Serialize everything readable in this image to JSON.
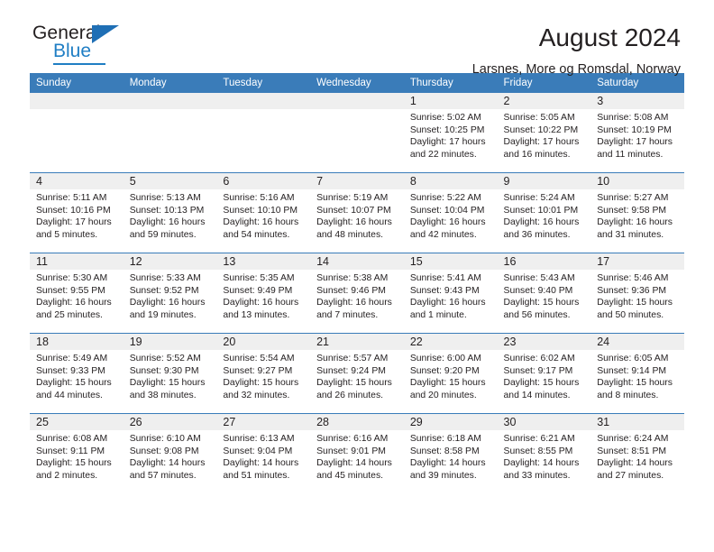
{
  "brand": {
    "name_top": "General",
    "name_bottom": "Blue",
    "triangle_color": "#1f6fb5",
    "blue_color": "#1f7ec4"
  },
  "header": {
    "title": "August 2024",
    "subtitle": "Larsnes, More og Romsdal, Norway",
    "header_bg": "#3a7cb9",
    "daynum_bg": "#efefef"
  },
  "weekdays": [
    "Sunday",
    "Monday",
    "Tuesday",
    "Wednesday",
    "Thursday",
    "Friday",
    "Saturday"
  ],
  "weeks": [
    [
      {
        "day": "",
        "empty": true
      },
      {
        "day": "",
        "empty": true
      },
      {
        "day": "",
        "empty": true
      },
      {
        "day": "",
        "empty": true
      },
      {
        "day": "1",
        "sunrise": "Sunrise: 5:02 AM",
        "sunset": "Sunset: 10:25 PM",
        "daylight1": "Daylight: 17 hours",
        "daylight2": "and 22 minutes."
      },
      {
        "day": "2",
        "sunrise": "Sunrise: 5:05 AM",
        "sunset": "Sunset: 10:22 PM",
        "daylight1": "Daylight: 17 hours",
        "daylight2": "and 16 minutes."
      },
      {
        "day": "3",
        "sunrise": "Sunrise: 5:08 AM",
        "sunset": "Sunset: 10:19 PM",
        "daylight1": "Daylight: 17 hours",
        "daylight2": "and 11 minutes."
      }
    ],
    [
      {
        "day": "4",
        "sunrise": "Sunrise: 5:11 AM",
        "sunset": "Sunset: 10:16 PM",
        "daylight1": "Daylight: 17 hours",
        "daylight2": "and 5 minutes."
      },
      {
        "day": "5",
        "sunrise": "Sunrise: 5:13 AM",
        "sunset": "Sunset: 10:13 PM",
        "daylight1": "Daylight: 16 hours",
        "daylight2": "and 59 minutes."
      },
      {
        "day": "6",
        "sunrise": "Sunrise: 5:16 AM",
        "sunset": "Sunset: 10:10 PM",
        "daylight1": "Daylight: 16 hours",
        "daylight2": "and 54 minutes."
      },
      {
        "day": "7",
        "sunrise": "Sunrise: 5:19 AM",
        "sunset": "Sunset: 10:07 PM",
        "daylight1": "Daylight: 16 hours",
        "daylight2": "and 48 minutes."
      },
      {
        "day": "8",
        "sunrise": "Sunrise: 5:22 AM",
        "sunset": "Sunset: 10:04 PM",
        "daylight1": "Daylight: 16 hours",
        "daylight2": "and 42 minutes."
      },
      {
        "day": "9",
        "sunrise": "Sunrise: 5:24 AM",
        "sunset": "Sunset: 10:01 PM",
        "daylight1": "Daylight: 16 hours",
        "daylight2": "and 36 minutes."
      },
      {
        "day": "10",
        "sunrise": "Sunrise: 5:27 AM",
        "sunset": "Sunset: 9:58 PM",
        "daylight1": "Daylight: 16 hours",
        "daylight2": "and 31 minutes."
      }
    ],
    [
      {
        "day": "11",
        "sunrise": "Sunrise: 5:30 AM",
        "sunset": "Sunset: 9:55 PM",
        "daylight1": "Daylight: 16 hours",
        "daylight2": "and 25 minutes."
      },
      {
        "day": "12",
        "sunrise": "Sunrise: 5:33 AM",
        "sunset": "Sunset: 9:52 PM",
        "daylight1": "Daylight: 16 hours",
        "daylight2": "and 19 minutes."
      },
      {
        "day": "13",
        "sunrise": "Sunrise: 5:35 AM",
        "sunset": "Sunset: 9:49 PM",
        "daylight1": "Daylight: 16 hours",
        "daylight2": "and 13 minutes."
      },
      {
        "day": "14",
        "sunrise": "Sunrise: 5:38 AM",
        "sunset": "Sunset: 9:46 PM",
        "daylight1": "Daylight: 16 hours",
        "daylight2": "and 7 minutes."
      },
      {
        "day": "15",
        "sunrise": "Sunrise: 5:41 AM",
        "sunset": "Sunset: 9:43 PM",
        "daylight1": "Daylight: 16 hours",
        "daylight2": "and 1 minute."
      },
      {
        "day": "16",
        "sunrise": "Sunrise: 5:43 AM",
        "sunset": "Sunset: 9:40 PM",
        "daylight1": "Daylight: 15 hours",
        "daylight2": "and 56 minutes."
      },
      {
        "day": "17",
        "sunrise": "Sunrise: 5:46 AM",
        "sunset": "Sunset: 9:36 PM",
        "daylight1": "Daylight: 15 hours",
        "daylight2": "and 50 minutes."
      }
    ],
    [
      {
        "day": "18",
        "sunrise": "Sunrise: 5:49 AM",
        "sunset": "Sunset: 9:33 PM",
        "daylight1": "Daylight: 15 hours",
        "daylight2": "and 44 minutes."
      },
      {
        "day": "19",
        "sunrise": "Sunrise: 5:52 AM",
        "sunset": "Sunset: 9:30 PM",
        "daylight1": "Daylight: 15 hours",
        "daylight2": "and 38 minutes."
      },
      {
        "day": "20",
        "sunrise": "Sunrise: 5:54 AM",
        "sunset": "Sunset: 9:27 PM",
        "daylight1": "Daylight: 15 hours",
        "daylight2": "and 32 minutes."
      },
      {
        "day": "21",
        "sunrise": "Sunrise: 5:57 AM",
        "sunset": "Sunset: 9:24 PM",
        "daylight1": "Daylight: 15 hours",
        "daylight2": "and 26 minutes."
      },
      {
        "day": "22",
        "sunrise": "Sunrise: 6:00 AM",
        "sunset": "Sunset: 9:20 PM",
        "daylight1": "Daylight: 15 hours",
        "daylight2": "and 20 minutes."
      },
      {
        "day": "23",
        "sunrise": "Sunrise: 6:02 AM",
        "sunset": "Sunset: 9:17 PM",
        "daylight1": "Daylight: 15 hours",
        "daylight2": "and 14 minutes."
      },
      {
        "day": "24",
        "sunrise": "Sunrise: 6:05 AM",
        "sunset": "Sunset: 9:14 PM",
        "daylight1": "Daylight: 15 hours",
        "daylight2": "and 8 minutes."
      }
    ],
    [
      {
        "day": "25",
        "sunrise": "Sunrise: 6:08 AM",
        "sunset": "Sunset: 9:11 PM",
        "daylight1": "Daylight: 15 hours",
        "daylight2": "and 2 minutes."
      },
      {
        "day": "26",
        "sunrise": "Sunrise: 6:10 AM",
        "sunset": "Sunset: 9:08 PM",
        "daylight1": "Daylight: 14 hours",
        "daylight2": "and 57 minutes."
      },
      {
        "day": "27",
        "sunrise": "Sunrise: 6:13 AM",
        "sunset": "Sunset: 9:04 PM",
        "daylight1": "Daylight: 14 hours",
        "daylight2": "and 51 minutes."
      },
      {
        "day": "28",
        "sunrise": "Sunrise: 6:16 AM",
        "sunset": "Sunset: 9:01 PM",
        "daylight1": "Daylight: 14 hours",
        "daylight2": "and 45 minutes."
      },
      {
        "day": "29",
        "sunrise": "Sunrise: 6:18 AM",
        "sunset": "Sunset: 8:58 PM",
        "daylight1": "Daylight: 14 hours",
        "daylight2": "and 39 minutes."
      },
      {
        "day": "30",
        "sunrise": "Sunrise: 6:21 AM",
        "sunset": "Sunset: 8:55 PM",
        "daylight1": "Daylight: 14 hours",
        "daylight2": "and 33 minutes."
      },
      {
        "day": "31",
        "sunrise": "Sunrise: 6:24 AM",
        "sunset": "Sunset: 8:51 PM",
        "daylight1": "Daylight: 14 hours",
        "daylight2": "and 27 minutes."
      }
    ]
  ]
}
